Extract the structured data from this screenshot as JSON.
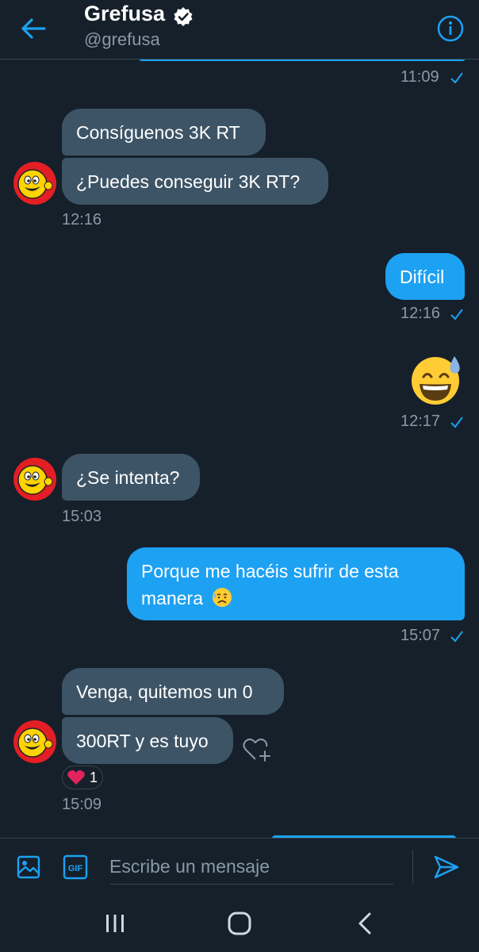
{
  "header": {
    "name": "Grefusa",
    "handle": "@grefusa"
  },
  "messages": [
    {
      "id": "t0",
      "time": "11:09"
    },
    {
      "id": "m1",
      "text": "Consíguenos 3K RT"
    },
    {
      "id": "m2",
      "text": "¿Puedes conseguir 3K RT?",
      "time": "12:16"
    },
    {
      "id": "m3",
      "text": "Difícil",
      "time": "12:16"
    },
    {
      "id": "m4",
      "emoji": "grinning-sweat-emoji",
      "time": "12:17"
    },
    {
      "id": "m5",
      "text": "¿Se intenta?",
      "time": "15:03"
    },
    {
      "id": "m6",
      "text": "Porque me hacéis sufrir de esta manera",
      "emoji": "disappointed-relieved-emoji",
      "time": "15:07"
    },
    {
      "id": "m7",
      "text": "Venga, quitemos un 0"
    },
    {
      "id": "m8",
      "text": "300RT y es tuyo",
      "time": "15:09",
      "reaction_count": "1"
    }
  ],
  "composer": {
    "placeholder": "Escribe un mensaje"
  },
  "colors": {
    "background": "#15202b",
    "incoming_bubble": "#3d5466",
    "outgoing_bubble": "#1da1f2",
    "accent": "#1da1f2",
    "muted_text": "#8899a6",
    "reaction_heart": "#e0245e"
  }
}
